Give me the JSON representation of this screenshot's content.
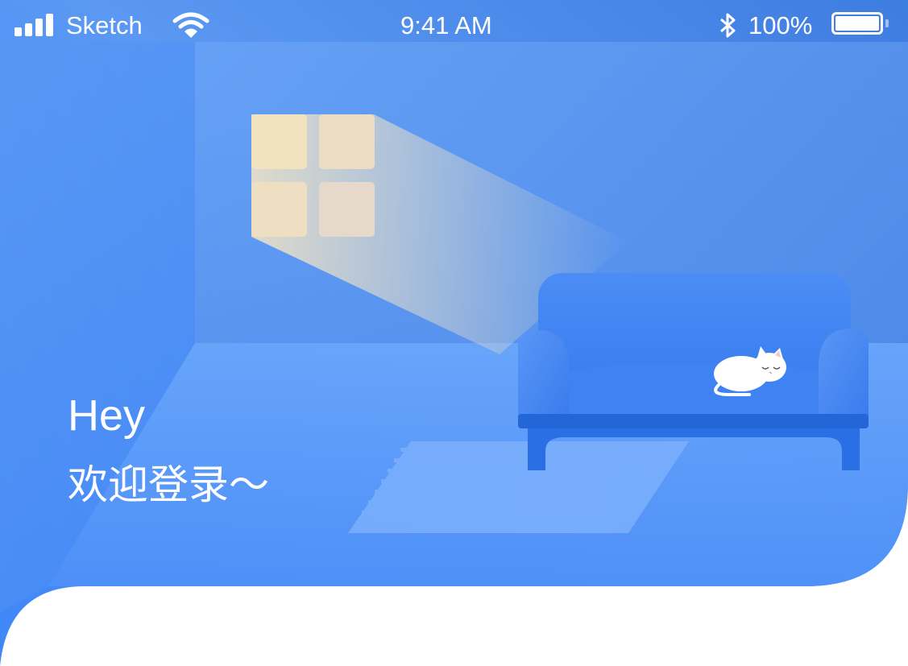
{
  "status_bar": {
    "carrier": "Sketch",
    "time": "9:41 AM",
    "battery_percent": "100%",
    "icons": [
      "signal-icon",
      "wifi-icon",
      "bluetooth-icon",
      "battery-icon"
    ],
    "battery_level": 1.0
  },
  "header": {
    "greeting": "Hey",
    "welcome": "欢迎登录～"
  },
  "colors": {
    "primary_blue": "#4a8efa",
    "deep_blue": "#3a7ae0",
    "window_light": "#f4e6c0",
    "background": "#ffffff"
  }
}
